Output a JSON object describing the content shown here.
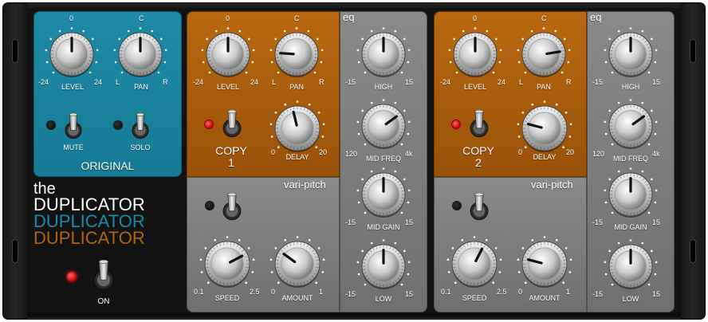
{
  "brand": {
    "the": "the",
    "lines": [
      "DUPLICATOR",
      "DUPLICATOR",
      "DUPLICATOR"
    ],
    "colors": [
      "#ffffff",
      "#1d89a8",
      "#b0650e"
    ]
  },
  "power": {
    "label": "ON",
    "on": true
  },
  "original": {
    "title": "ORIGINAL",
    "level": {
      "label": "LEVEL",
      "top": "0",
      "min": "-24",
      "max": "24",
      "value": 0.5
    },
    "pan": {
      "label": "PAN",
      "top": "C",
      "min": "L",
      "max": "R",
      "value": 0.5
    },
    "mute": {
      "label": "MUTE",
      "led_on": false
    },
    "solo": {
      "label": "SOLO",
      "led_on": false
    }
  },
  "copies": [
    {
      "title": "COPY",
      "num": "1",
      "level": {
        "label": "LEVEL",
        "top": "0",
        "min": "-24",
        "max": "24",
        "value": 0.5
      },
      "pan": {
        "label": "PAN",
        "top": "C",
        "min": "L",
        "max": "R",
        "value": 0.18
      },
      "delay": {
        "label": "DELAY",
        "min": "0",
        "max": "20",
        "value": 0.45
      },
      "led_on": true,
      "varipitch": {
        "title": "vari-pitch",
        "speed": {
          "label": "SPEED",
          "min": "0.1",
          "max": "2.5",
          "value": 0.73
        },
        "amount": {
          "label": "AMOUNT",
          "min": "0",
          "max": "1",
          "value": 0.3
        },
        "led_on": false
      },
      "eq": {
        "title": "eq",
        "high": {
          "label": "HIGH",
          "min": "-15",
          "max": "15",
          "value": 0.5
        },
        "midfreq": {
          "label": "MID FREQ",
          "min": "120",
          "max": "4k",
          "value": 0.7
        },
        "midgain": {
          "label": "MID GAIN",
          "min": "-15",
          "max": "15",
          "value": 0.5
        },
        "low": {
          "label": "LOW",
          "min": "-15",
          "max": "15",
          "value": 0.5
        }
      }
    },
    {
      "title": "COPY",
      "num": "2",
      "level": {
        "label": "LEVEL",
        "top": "0",
        "min": "-24",
        "max": "24",
        "value": 0.5
      },
      "pan": {
        "label": "PAN",
        "top": "C",
        "min": "L",
        "max": "R",
        "value": 0.8
      },
      "delay": {
        "label": "DELAY",
        "min": "0",
        "max": "20",
        "value": 0.22
      },
      "led_on": true,
      "varipitch": {
        "title": "vari-pitch",
        "speed": {
          "label": "SPEED",
          "min": "0.1",
          "max": "2.5",
          "value": 0.6
        },
        "amount": {
          "label": "AMOUNT",
          "min": "0",
          "max": "1",
          "value": 0.22
        },
        "led_on": false
      },
      "eq": {
        "title": "eq",
        "high": {
          "label": "HIGH",
          "min": "-15",
          "max": "15",
          "value": 0.5
        },
        "midfreq": {
          "label": "MID FREQ",
          "min": "120",
          "max": "4k",
          "value": 0.7
        },
        "midgain": {
          "label": "MID GAIN",
          "min": "-15",
          "max": "15",
          "value": 0.5
        },
        "low": {
          "label": "LOW",
          "min": "-15",
          "max": "15",
          "value": 0.5
        }
      }
    }
  ]
}
